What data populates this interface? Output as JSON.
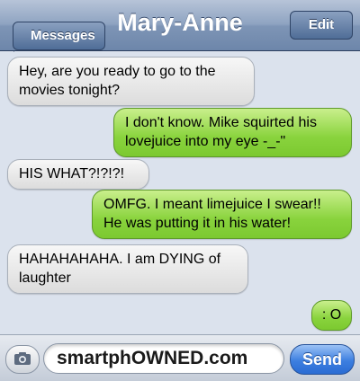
{
  "header": {
    "back_label": "Messages",
    "title": "Mary-Anne",
    "edit_label": "Edit"
  },
  "messages": [
    {
      "direction": "incoming",
      "text": "Hey, are you ready to go to the movies tonight?"
    },
    {
      "direction": "outgoing",
      "text": "I don't know. Mike squirted his lovejuice into my eye -_-\""
    },
    {
      "direction": "incoming",
      "text": "HIS WHAT?!?!?!"
    },
    {
      "direction": "outgoing",
      "text": "OMFG. I meant limejuice I swear!! He was putting it in his water!"
    },
    {
      "direction": "incoming",
      "text": "HAHAHAHAHA. I am DYING of laughter"
    },
    {
      "direction": "outgoing",
      "text": ": O"
    }
  ],
  "input": {
    "value": "smartphOWNED.com",
    "send_label": "Send",
    "camera_icon": "camera-icon"
  },
  "colors": {
    "incoming_bubble": "#e8e8e8",
    "outgoing_bubble": "#8fd547",
    "background": "#dbe2ed",
    "navbar": "#7e95b6",
    "send_button": "#3d7fe0"
  }
}
